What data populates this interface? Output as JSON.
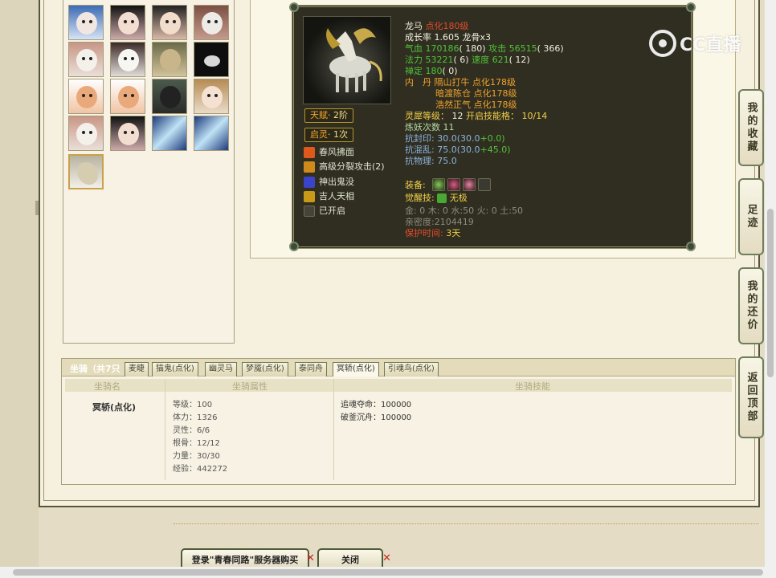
{
  "pet": {
    "name": "龙马",
    "rank": "点化180级",
    "growth": "成长率 1.605 龙骨x3",
    "hp_label": "气血",
    "hp_value": "170186",
    "hp_extra": "( 180)",
    "atk_label": "攻击",
    "atk_value": "56515",
    "atk_extra": "( 366)",
    "mp_label": "法力",
    "mp_value": "53221",
    "mp_extra": "( 6)",
    "spd_label": "速度",
    "spd_value": "621",
    "spd_extra": "( 12)",
    "focus_label": "禅定",
    "focus_value": "180",
    "focus_extra": "( 0)",
    "elixir_line1": "内　丹 隔山打牛 点化178级",
    "elixir_line2": "暗渡陈仓 点化178级",
    "elixir_line3": "浩然正气 点化178级",
    "spirit_label": "灵犀等级：",
    "spirit_value": "12",
    "spirit_slot_label": "开启技能格：",
    "spirit_slot_value": "10/14",
    "refine": "炼妖次数 11",
    "resist_seal_label": "抗封印:",
    "resist_seal_base": "30.0(30.0",
    "resist_seal_bonus": "+0.0)",
    "resist_chaos_label": "抗混乱:",
    "resist_chaos_base": "75.0(30.0",
    "resist_chaos_bonus": "+45.0)",
    "resist_phys": "抗物理: 75.0",
    "equip_label": "装备:",
    "awaken_label": "觉醒技:",
    "awaken_value": "无极",
    "elements": "金: 0 木: 0 水:50 火: 0 土:50",
    "intimacy": "亲密度:2104419",
    "protect_label": "保护时间:",
    "protect_value": "3天",
    "talent_label": "天赋",
    "talent_value": "· 2阶",
    "inspire_label": "启灵",
    "inspire_value": "· 1次",
    "skills": [
      {
        "label": "春风拂面",
        "icon": "fire-skill-icon",
        "color": "#e0581c"
      },
      {
        "label": "高级分裂攻击(2)",
        "icon": "split-attack-icon",
        "color": "#d08a1c"
      },
      {
        "label": "神出鬼没",
        "icon": "ghost-skill-icon",
        "color": "#3b44c8"
      },
      {
        "label": "吉人天相",
        "icon": "fortune-skill-icon",
        "color": "#c99a18"
      },
      {
        "label": "已开启",
        "icon": "locked-slot-icon",
        "color": "#444438"
      }
    ]
  },
  "watermark": {
    "text": "CC直播"
  },
  "side_nav": [
    {
      "label": "我的收藏"
    },
    {
      "label": "足迹"
    },
    {
      "label": "我的还价"
    },
    {
      "label": "返回顶部"
    }
  ],
  "mount": {
    "title": "坐骑（共7只",
    "tabs": [
      "麦睫",
      "猫鬼(点化)",
      "幽灵马",
      "梦魇(点化)",
      "泰同舟",
      "冥轿(点化)",
      "引魂鸟(点化)"
    ],
    "active_tab": 5,
    "header_name": "坐骑名",
    "header_attr": "坐骑属性",
    "header_skill": "坐骑技能",
    "name": "冥轿(点化)",
    "attrs": [
      "等级：100",
      "体力：1326",
      "灵性：6/6",
      "根骨：12/12",
      "力量：30/30",
      "经验：442272"
    ],
    "skills": [
      "追魂夺命：100000",
      "破釜沉舟：100000"
    ]
  },
  "buttons": {
    "login_buy": "登录\"青春同路\"服务器购买",
    "close": "关闭"
  },
  "colors": {
    "panel_dark": "#302e21",
    "frame_green": "#6f7d5b",
    "accent_orange": "#f0a32c",
    "stat_green": "#52c23a"
  }
}
